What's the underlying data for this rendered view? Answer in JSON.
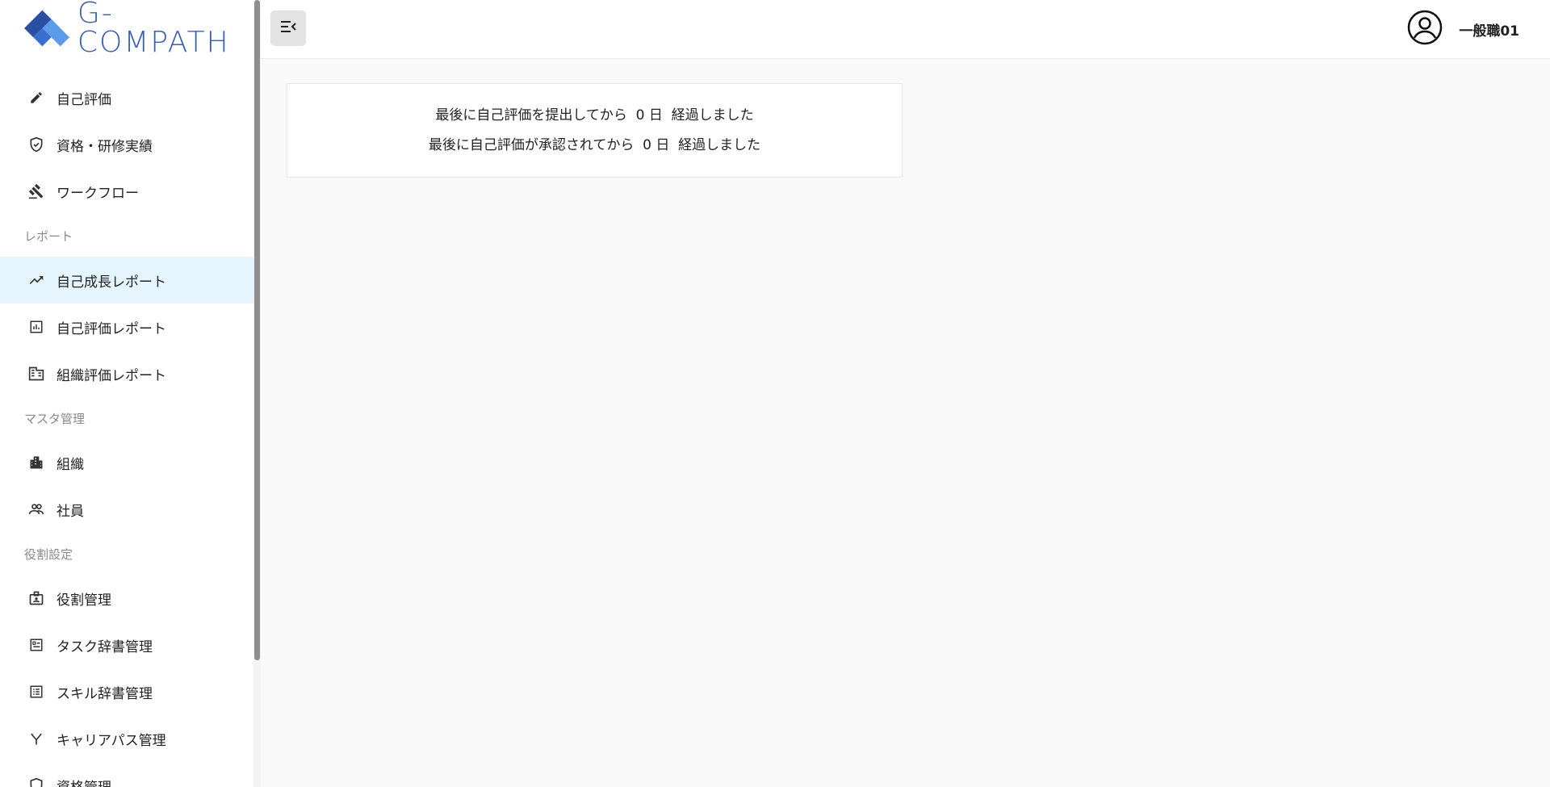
{
  "app": {
    "logo_text": "G-COMPATH"
  },
  "colors": {
    "brand_dark": "#2b4fa3",
    "brand_light": "#4d8fe0",
    "active_bg": "#e4f5fd"
  },
  "sidebar": {
    "items": [
      {
        "label": "自己評価",
        "icon": "pencil-icon"
      },
      {
        "label": "資格・研修実績",
        "icon": "shield-check-icon"
      },
      {
        "label": "ワークフロー",
        "icon": "gavel-icon"
      }
    ],
    "section_report": "レポート",
    "report_items": [
      {
        "label": "自己成長レポート",
        "icon": "trending-up-icon"
      },
      {
        "label": "自己評価レポート",
        "icon": "bar-chart-icon"
      },
      {
        "label": "組織評価レポート",
        "icon": "building-icon"
      }
    ],
    "section_master": "マスタ管理",
    "master_items": [
      {
        "label": "組織",
        "icon": "buildings-icon"
      },
      {
        "label": "社員",
        "icon": "people-icon"
      }
    ],
    "section_role": "役割設定",
    "role_items": [
      {
        "label": "役割管理",
        "icon": "badge-icon"
      },
      {
        "label": "タスク辞書管理",
        "icon": "task-book-icon"
      },
      {
        "label": "スキル辞書管理",
        "icon": "list-book-icon"
      },
      {
        "label": "キャリアパス管理",
        "icon": "fork-icon"
      },
      {
        "label": "資格管理",
        "icon": "shield-icon"
      }
    ]
  },
  "header": {
    "user_name": "一般職01"
  },
  "main": {
    "line1": "最後に自己評価を提出してから  0 日  経過しました",
    "line2": "最後に自己評価が承認されてから  0 日  経過しました"
  }
}
